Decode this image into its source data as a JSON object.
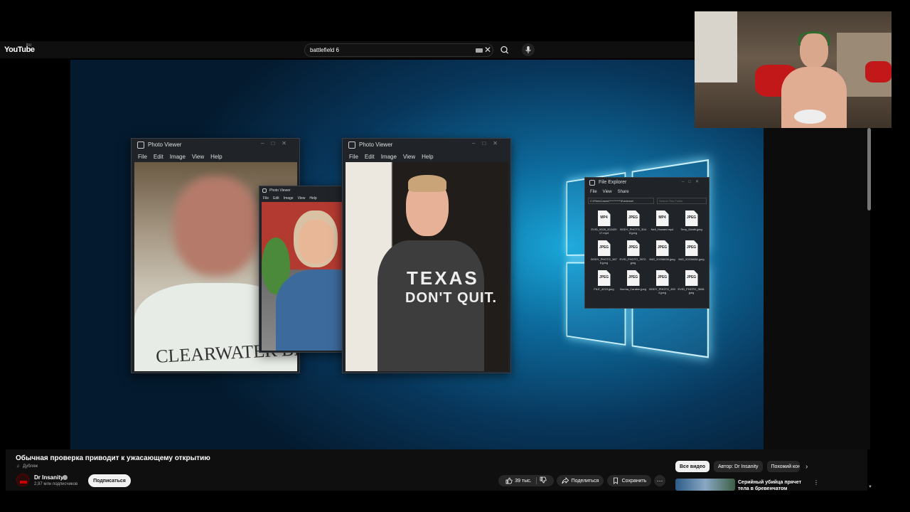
{
  "youtube": {
    "logo": "YouTube",
    "region": "RU",
    "search_value": "battlefield 6",
    "icons": {
      "keyboard": "keyboard-icon",
      "clear": "close-icon",
      "search": "search-icon",
      "voice": "mic-icon"
    },
    "clear_glyph": "✕"
  },
  "video": {
    "photo_viewer_1": {
      "title": "Photo Viewer",
      "menu": [
        "File",
        "Edit",
        "Image",
        "View",
        "Help"
      ],
      "shirt_text": "CLEARWATER BEACH"
    },
    "photo_viewer_2": {
      "title": "Photo Viewer",
      "menu": [
        "File",
        "Edit",
        "Image",
        "View",
        "Help"
      ]
    },
    "photo_viewer_3": {
      "title": "Photo Viewer",
      "menu": [
        "File",
        "Edit",
        "Image",
        "View",
        "Help"
      ],
      "shirt_line1": "TEXAS",
      "shirt_line2": "DON'T QUIT."
    },
    "file_explorer": {
      "title": "File Explorer",
      "menu": [
        "File",
        "View",
        "Share"
      ],
      "path": "C:\\Files\\Cases\\**********\\Evidence\\",
      "search_placeholder": "Search This Folder",
      "files": [
        {
          "ext": "MP4",
          "name": "EVID_9328_20242017.mp4"
        },
        {
          "ext": "JPEG",
          "name": "BODY_PHOTO_3048.jpeg"
        },
        {
          "ext": "MP4",
          "name": "Neil_Howard.mp4"
        },
        {
          "ext": "JPEG",
          "name": "Terry_Death.jpeg"
        },
        {
          "ext": "JPEG",
          "name": "BODY_PHOTO_3876.jpeg"
        },
        {
          "ext": "JPEG",
          "name": "EVID_PHOTO_3972.jpeg"
        },
        {
          "ext": "JPEG",
          "name": "IMG_20206630.jpeg"
        },
        {
          "ext": "JPEG",
          "name": "IMG_20234681.jpeg"
        },
        {
          "ext": "JPEG",
          "name": "FILE_4219.jpeg"
        },
        {
          "ext": "JPEG",
          "name": "Norma_Carabin.jpeg"
        },
        {
          "ext": "JPEG",
          "name": "BODY_PHOTO_4504.jpeg"
        },
        {
          "ext": "JPEG",
          "name": "EVID_PHOTO_3608.jpeg"
        }
      ]
    }
  },
  "info": {
    "title": "Обычная проверка приводит к ужасающему открытию",
    "dubbing": "Дубляж",
    "channel": "Dr Insanity",
    "subscribers": "2,97 млн подписчиков",
    "subscribe_label": "Подписаться",
    "likes": "39 тыс.",
    "share_label": "Поделиться",
    "save_label": "Сохранить",
    "more_glyph": "···",
    "chips": [
      "Все видео",
      "Автор: Dr Insanity",
      "Похожий контент"
    ],
    "chip_next": "›",
    "recommended_title": "Серийный убийца прячет тела в бревенчатом сооружении",
    "rec_more": "⋮",
    "scroll_down": "▼"
  }
}
